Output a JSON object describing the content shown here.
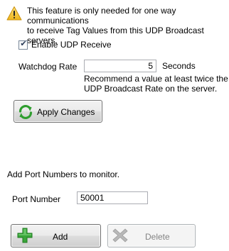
{
  "warning": {
    "icon": "warning-triangle-icon",
    "line1": "This feature is only needed for one way communications",
    "line2": "to receive Tag Values from this UDP Broadcast servers."
  },
  "udp": {
    "enable_label": "Enable UDP Receive",
    "enabled": true
  },
  "watchdog": {
    "label": "Watchdog Rate",
    "value": "5",
    "unit": "Seconds",
    "hint_line1": "Recommend a value at least twice the",
    "hint_line2": "UDP Broadcast Rate on the server."
  },
  "apply_button": {
    "label": "Apply Changes",
    "icon": "refresh-arrows-icon"
  },
  "ports": {
    "heading": "Add Port Numbers to monitor.",
    "port_label": "Port Number",
    "port_value": "50001"
  },
  "add_button": {
    "label": "Add",
    "icon": "green-plus-icon"
  },
  "delete_button": {
    "label": "Delete",
    "icon": "gray-x-icon",
    "enabled": false
  },
  "colors": {
    "warning_fill": "#f4c430",
    "refresh_green": "#2f9e2f",
    "plus_green": "#3aa53a"
  }
}
